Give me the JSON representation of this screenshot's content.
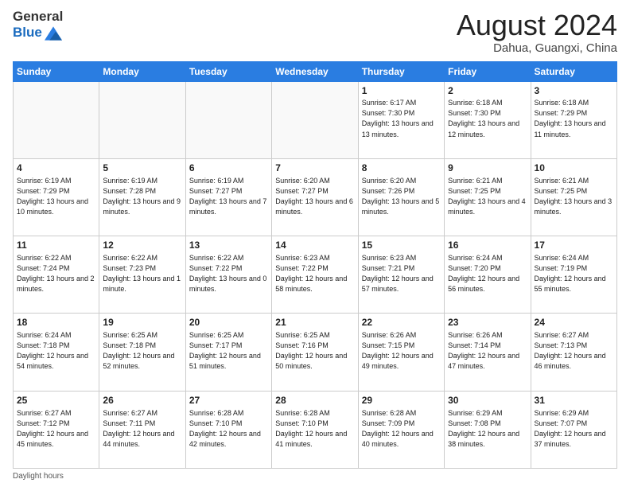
{
  "header": {
    "logo": {
      "general": "General",
      "blue": "Blue"
    },
    "title": "August 2024",
    "location": "Dahua, Guangxi, China"
  },
  "weekdays": [
    "Sunday",
    "Monday",
    "Tuesday",
    "Wednesday",
    "Thursday",
    "Friday",
    "Saturday"
  ],
  "weeks": [
    [
      {
        "day": "",
        "info": ""
      },
      {
        "day": "",
        "info": ""
      },
      {
        "day": "",
        "info": ""
      },
      {
        "day": "",
        "info": ""
      },
      {
        "day": "1",
        "info": "Sunrise: 6:17 AM\nSunset: 7:30 PM\nDaylight: 13 hours\nand 13 minutes."
      },
      {
        "day": "2",
        "info": "Sunrise: 6:18 AM\nSunset: 7:30 PM\nDaylight: 13 hours\nand 12 minutes."
      },
      {
        "day": "3",
        "info": "Sunrise: 6:18 AM\nSunset: 7:29 PM\nDaylight: 13 hours\nand 11 minutes."
      }
    ],
    [
      {
        "day": "4",
        "info": "Sunrise: 6:19 AM\nSunset: 7:29 PM\nDaylight: 13 hours\nand 10 minutes."
      },
      {
        "day": "5",
        "info": "Sunrise: 6:19 AM\nSunset: 7:28 PM\nDaylight: 13 hours\nand 9 minutes."
      },
      {
        "day": "6",
        "info": "Sunrise: 6:19 AM\nSunset: 7:27 PM\nDaylight: 13 hours\nand 7 minutes."
      },
      {
        "day": "7",
        "info": "Sunrise: 6:20 AM\nSunset: 7:27 PM\nDaylight: 13 hours\nand 6 minutes."
      },
      {
        "day": "8",
        "info": "Sunrise: 6:20 AM\nSunset: 7:26 PM\nDaylight: 13 hours\nand 5 minutes."
      },
      {
        "day": "9",
        "info": "Sunrise: 6:21 AM\nSunset: 7:25 PM\nDaylight: 13 hours\nand 4 minutes."
      },
      {
        "day": "10",
        "info": "Sunrise: 6:21 AM\nSunset: 7:25 PM\nDaylight: 13 hours\nand 3 minutes."
      }
    ],
    [
      {
        "day": "11",
        "info": "Sunrise: 6:22 AM\nSunset: 7:24 PM\nDaylight: 13 hours\nand 2 minutes."
      },
      {
        "day": "12",
        "info": "Sunrise: 6:22 AM\nSunset: 7:23 PM\nDaylight: 13 hours\nand 1 minute."
      },
      {
        "day": "13",
        "info": "Sunrise: 6:22 AM\nSunset: 7:22 PM\nDaylight: 13 hours\nand 0 minutes."
      },
      {
        "day": "14",
        "info": "Sunrise: 6:23 AM\nSunset: 7:22 PM\nDaylight: 12 hours\nand 58 minutes."
      },
      {
        "day": "15",
        "info": "Sunrise: 6:23 AM\nSunset: 7:21 PM\nDaylight: 12 hours\nand 57 minutes."
      },
      {
        "day": "16",
        "info": "Sunrise: 6:24 AM\nSunset: 7:20 PM\nDaylight: 12 hours\nand 56 minutes."
      },
      {
        "day": "17",
        "info": "Sunrise: 6:24 AM\nSunset: 7:19 PM\nDaylight: 12 hours\nand 55 minutes."
      }
    ],
    [
      {
        "day": "18",
        "info": "Sunrise: 6:24 AM\nSunset: 7:18 PM\nDaylight: 12 hours\nand 54 minutes."
      },
      {
        "day": "19",
        "info": "Sunrise: 6:25 AM\nSunset: 7:18 PM\nDaylight: 12 hours\nand 52 minutes."
      },
      {
        "day": "20",
        "info": "Sunrise: 6:25 AM\nSunset: 7:17 PM\nDaylight: 12 hours\nand 51 minutes."
      },
      {
        "day": "21",
        "info": "Sunrise: 6:25 AM\nSunset: 7:16 PM\nDaylight: 12 hours\nand 50 minutes."
      },
      {
        "day": "22",
        "info": "Sunrise: 6:26 AM\nSunset: 7:15 PM\nDaylight: 12 hours\nand 49 minutes."
      },
      {
        "day": "23",
        "info": "Sunrise: 6:26 AM\nSunset: 7:14 PM\nDaylight: 12 hours\nand 47 minutes."
      },
      {
        "day": "24",
        "info": "Sunrise: 6:27 AM\nSunset: 7:13 PM\nDaylight: 12 hours\nand 46 minutes."
      }
    ],
    [
      {
        "day": "25",
        "info": "Sunrise: 6:27 AM\nSunset: 7:12 PM\nDaylight: 12 hours\nand 45 minutes."
      },
      {
        "day": "26",
        "info": "Sunrise: 6:27 AM\nSunset: 7:11 PM\nDaylight: 12 hours\nand 44 minutes."
      },
      {
        "day": "27",
        "info": "Sunrise: 6:28 AM\nSunset: 7:10 PM\nDaylight: 12 hours\nand 42 minutes."
      },
      {
        "day": "28",
        "info": "Sunrise: 6:28 AM\nSunset: 7:10 PM\nDaylight: 12 hours\nand 41 minutes."
      },
      {
        "day": "29",
        "info": "Sunrise: 6:28 AM\nSunset: 7:09 PM\nDaylight: 12 hours\nand 40 minutes."
      },
      {
        "day": "30",
        "info": "Sunrise: 6:29 AM\nSunset: 7:08 PM\nDaylight: 12 hours\nand 38 minutes."
      },
      {
        "day": "31",
        "info": "Sunrise: 6:29 AM\nSunset: 7:07 PM\nDaylight: 12 hours\nand 37 minutes."
      }
    ]
  ],
  "footer": {
    "daylight_label": "Daylight hours"
  }
}
